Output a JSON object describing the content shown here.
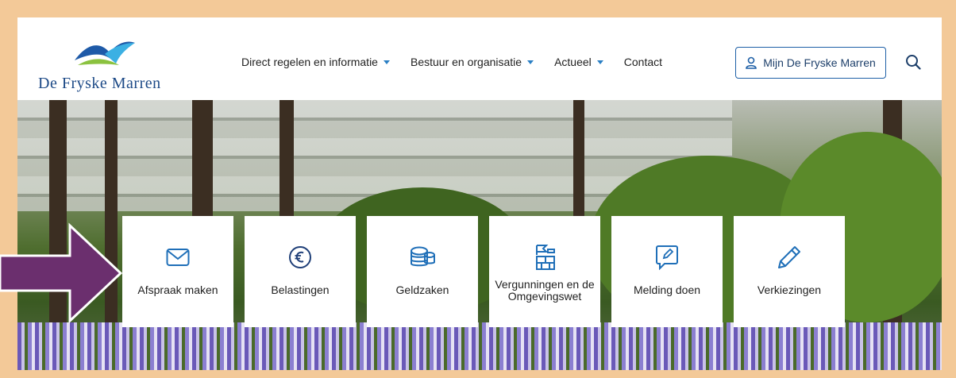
{
  "logo": {
    "text": "De Fryske Marren"
  },
  "nav": {
    "items": [
      {
        "label": "Direct regelen en informatie",
        "has_dropdown": true
      },
      {
        "label": "Bestuur en organisatie",
        "has_dropdown": true
      },
      {
        "label": "Actueel",
        "has_dropdown": true
      },
      {
        "label": "Contact",
        "has_dropdown": false
      }
    ]
  },
  "mijn_button": {
    "label": "Mijn De Fryske Marren",
    "icon": "user-icon"
  },
  "search": {
    "icon": "search-icon"
  },
  "tiles": [
    {
      "label": "Afspraak maken",
      "icon": "envelope-icon"
    },
    {
      "label": "Belastingen",
      "icon": "euro-icon"
    },
    {
      "label": "Geldzaken",
      "icon": "coins-icon"
    },
    {
      "label": "Vergunningen en de Omgevingswet",
      "icon": "permit-icon"
    },
    {
      "label": "Melding doen",
      "icon": "report-icon"
    },
    {
      "label": "Verkiezingen",
      "icon": "pencil-icon"
    }
  ],
  "colors": {
    "border": "#f3c998",
    "accent_blue": "#1d5fa6",
    "arrow_purple": "#6b2f6e",
    "icon_blue": "#1f6fb8"
  }
}
